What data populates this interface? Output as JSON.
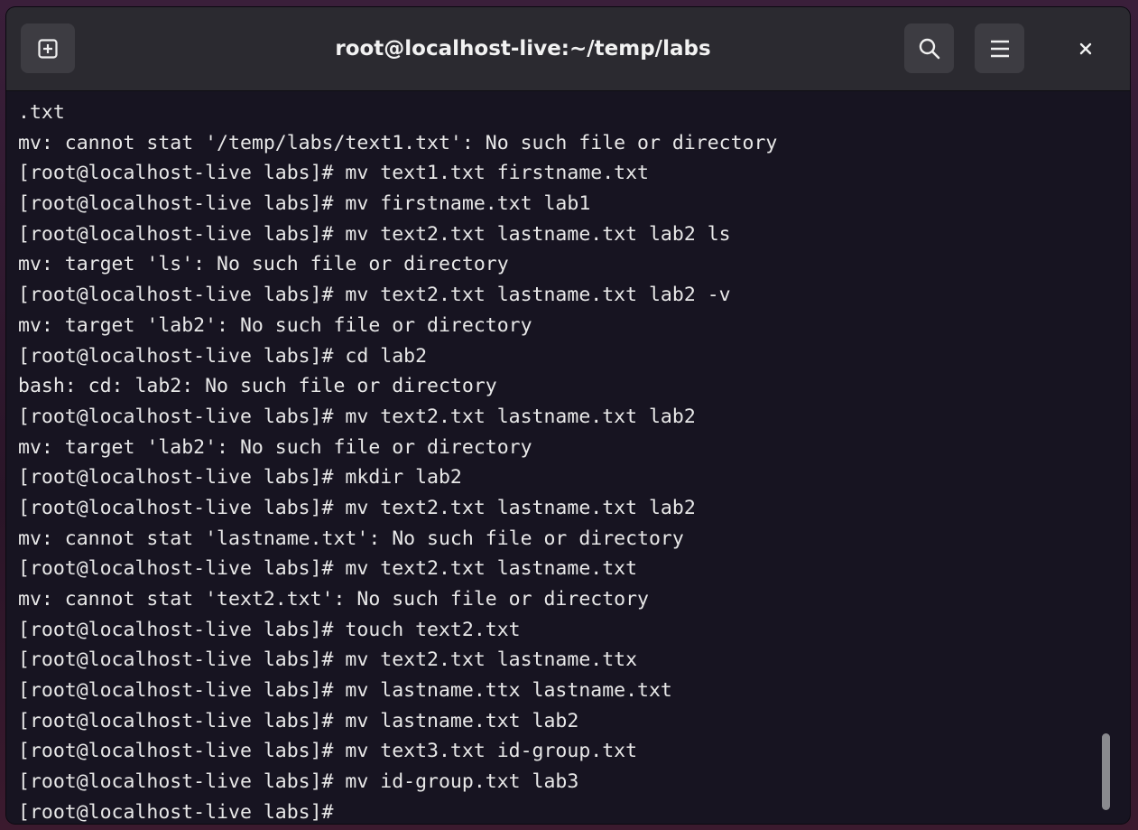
{
  "window": {
    "title": "root@localhost-live:~/temp/labs"
  },
  "icons": {
    "new_tab": "new-tab-icon",
    "search": "search-icon",
    "menu": "hamburger-menu-icon",
    "close": "close-icon"
  },
  "terminal": {
    "lines": [
      ".txt",
      "mv: cannot stat '/temp/labs/text1.txt': No such file or directory",
      "[root@localhost-live labs]# mv text1.txt firstname.txt",
      "[root@localhost-live labs]# mv firstname.txt lab1",
      "[root@localhost-live labs]# mv text2.txt lastname.txt lab2 ls",
      "mv: target 'ls': No such file or directory",
      "[root@localhost-live labs]# mv text2.txt lastname.txt lab2 -v",
      "mv: target 'lab2': No such file or directory",
      "[root@localhost-live labs]# cd lab2",
      "bash: cd: lab2: No such file or directory",
      "[root@localhost-live labs]# mv text2.txt lastname.txt lab2",
      "mv: target 'lab2': No such file or directory",
      "[root@localhost-live labs]# mkdir lab2",
      "[root@localhost-live labs]# mv text2.txt lastname.txt lab2",
      "mv: cannot stat 'lastname.txt': No such file or directory",
      "[root@localhost-live labs]# mv text2.txt lastname.txt",
      "mv: cannot stat 'text2.txt': No such file or directory",
      "[root@localhost-live labs]# touch text2.txt",
      "[root@localhost-live labs]# mv text2.txt lastname.ttx",
      "[root@localhost-live labs]# mv lastname.ttx lastname.txt",
      "[root@localhost-live labs]# mv lastname.txt lab2",
      "[root@localhost-live labs]# mv text3.txt id-group.txt",
      "[root@localhost-live labs]# mv id-group.txt lab3",
      "[root@localhost-live labs]#"
    ]
  },
  "colors": {
    "terminal_bg": "#171421",
    "headerbar_bg": "#2b2a30",
    "button_bg": "#3d3c42",
    "text": "#e8e8e8"
  }
}
